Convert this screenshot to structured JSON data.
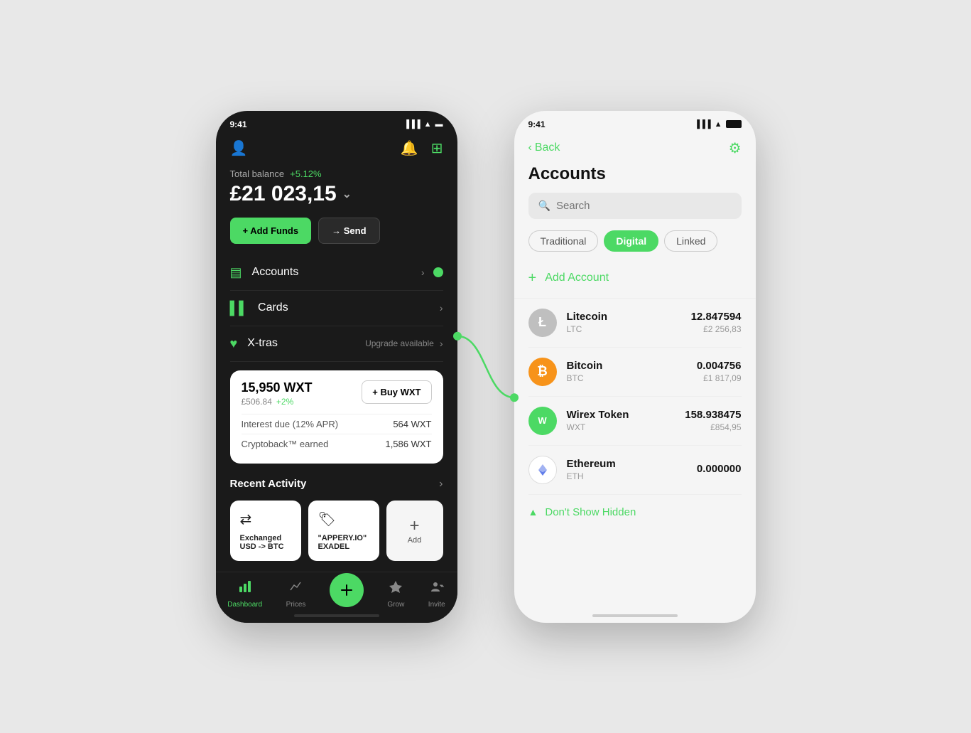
{
  "dark_phone": {
    "status_time": "9:41",
    "balance_label": "Total balance",
    "balance_change": "+5.12%",
    "balance_amount": "£21 023,15",
    "add_funds_label": "+ Add Funds",
    "send_label": "→ Send",
    "menu_items": [
      {
        "label": "Accounts",
        "note": "",
        "icon": "▤"
      },
      {
        "label": "Cards",
        "note": "",
        "icon": "▌▌"
      },
      {
        "label": "X-tras",
        "note": "Upgrade available",
        "icon": "♥"
      }
    ],
    "wxt_card": {
      "amount": "15,950 WXT",
      "gbp": "£506.84",
      "change": "+2%",
      "buy_label": "+ Buy WXT",
      "rows": [
        {
          "label": "Interest due (12% APR)",
          "value": "564 WXT"
        },
        {
          "label": "Cryptoback™ earned",
          "value": "1,586 WXT"
        }
      ]
    },
    "recent_activity": {
      "title": "Recent Activity",
      "cards": [
        {
          "icon": "⇄",
          "label": "Exchanged\nUSD -> BTC"
        },
        {
          "icon": "🏷",
          "label": "\"APPERY.IO\"\nEXADEL"
        },
        {
          "icon": "+",
          "label": "Add"
        }
      ]
    },
    "nav": [
      {
        "icon": "📊",
        "label": "Dashboard",
        "active": true
      },
      {
        "icon": "𝓌",
        "label": "Prices",
        "active": false
      },
      {
        "icon": "⇄",
        "label": "",
        "active": false,
        "center": true
      },
      {
        "icon": "✦",
        "label": "Grow",
        "active": false
      },
      {
        "icon": "👤+",
        "label": "Invite",
        "active": false
      }
    ]
  },
  "light_phone": {
    "status_time": "9:41",
    "back_label": "Back",
    "gear_icon": "⚙",
    "title": "Accounts",
    "search_placeholder": "Search",
    "tabs": [
      {
        "label": "Traditional",
        "active": false
      },
      {
        "label": "Digital",
        "active": true
      },
      {
        "label": "Linked",
        "active": false
      }
    ],
    "add_account_label": "Add Account",
    "accounts": [
      {
        "name": "Litecoin",
        "code": "LTC",
        "amount": "12.847594",
        "gbp": "£2 256,83",
        "icon_text": "Ł",
        "icon_class": "coin-ltc"
      },
      {
        "name": "Bitcoin",
        "code": "BTC",
        "amount": "0.004756",
        "gbp": "£1 817,09",
        "icon_text": "₿",
        "icon_class": "coin-btc"
      },
      {
        "name": "Wirex Token",
        "code": "WXT",
        "amount": "158.938475",
        "gbp": "£854,95",
        "icon_text": "W",
        "icon_class": "coin-wxt"
      },
      {
        "name": "Ethereum",
        "code": "ETH",
        "amount": "0.000000",
        "gbp": "",
        "icon_text": "⬡",
        "icon_class": "coin-eth"
      }
    ],
    "dont_show_label": "Don't Show Hidden"
  },
  "colors": {
    "green": "#4cd964",
    "dark_bg": "#1a1a1a",
    "light_bg": "#f5f5f5"
  }
}
